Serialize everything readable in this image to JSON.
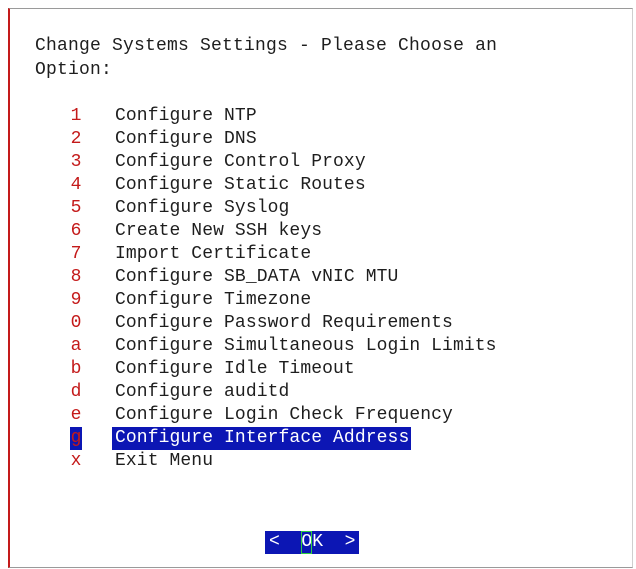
{
  "dialog": {
    "title": "Change Systems Settings - Please Choose an\nOption:"
  },
  "menu": {
    "items": [
      {
        "key": "1",
        "label": "Configure NTP"
      },
      {
        "key": "2",
        "label": "Configure DNS"
      },
      {
        "key": "3",
        "label": "Configure Control Proxy"
      },
      {
        "key": "4",
        "label": "Configure Static Routes"
      },
      {
        "key": "5",
        "label": "Configure Syslog"
      },
      {
        "key": "6",
        "label": "Create New SSH keys"
      },
      {
        "key": "7",
        "label": "Import Certificate"
      },
      {
        "key": "8",
        "label": "Configure SB_DATA vNIC MTU"
      },
      {
        "key": "9",
        "label": "Configure Timezone"
      },
      {
        "key": "0",
        "label": "Configure Password Requirements"
      },
      {
        "key": "a",
        "label": "Configure Simultaneous Login Limits"
      },
      {
        "key": "b",
        "label": "Configure Idle Timeout"
      },
      {
        "key": "d",
        "label": "Configure auditd"
      },
      {
        "key": "e",
        "label": "Configure Login Check Frequency"
      },
      {
        "key": "g",
        "label": "Configure Interface Address"
      },
      {
        "key": "x",
        "label": "Exit Menu"
      }
    ],
    "selected_key": "g"
  },
  "buttons": {
    "ok": {
      "left_bracket": "<",
      "hotkey": "O",
      "rest": "K",
      "right_bracket": ">"
    }
  },
  "colors": {
    "hotkey": "#c41a1a",
    "selection_bg": "#0c16b4",
    "selection_fg": "#ffffff",
    "text": "#1e1e1e",
    "cursor_outline": "#2ecc40"
  }
}
